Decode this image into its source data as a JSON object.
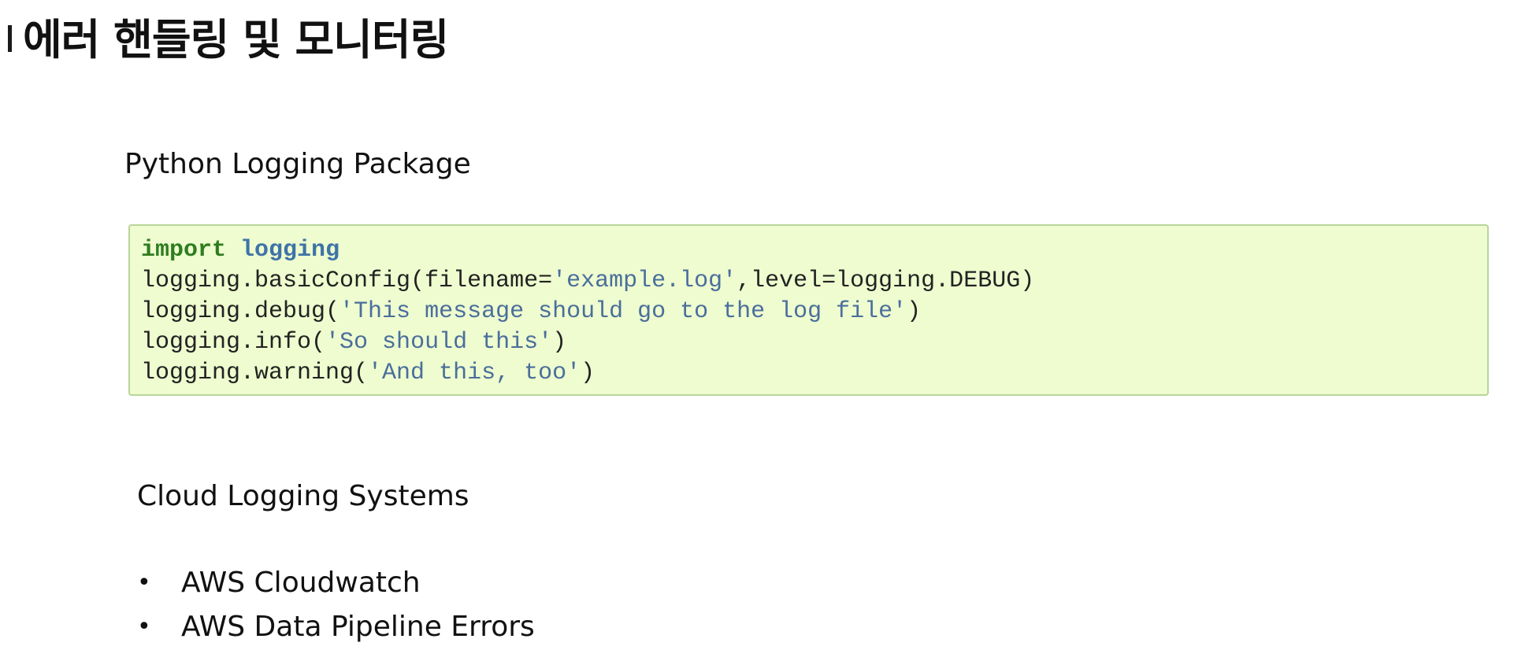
{
  "slide": {
    "title": "에러 핸들링 및 모니터링"
  },
  "python_section": {
    "heading": "Python Logging Package",
    "code": {
      "line1": {
        "keyword": "import",
        "sep": " ",
        "module": "logging"
      },
      "line2": {
        "a": "logging.basicConfig(filename=",
        "b": "'example.log'",
        "c": ",level=logging.DEBUG)"
      },
      "line3": {
        "a": "logging.debug(",
        "b": "'This message should go to the log file'",
        "c": ")"
      },
      "line4": {
        "a": "logging.info(",
        "b": "'So should this'",
        "c": ")"
      },
      "line5": {
        "a": "logging.warning(",
        "b": "'And this, too'",
        "c": ")"
      }
    }
  },
  "cloud_section": {
    "heading": "Cloud Logging Systems",
    "bullet_symbol": "•",
    "items": [
      {
        "label": "AWS Cloudwatch"
      },
      {
        "label": "AWS Data Pipeline Errors"
      }
    ]
  }
}
